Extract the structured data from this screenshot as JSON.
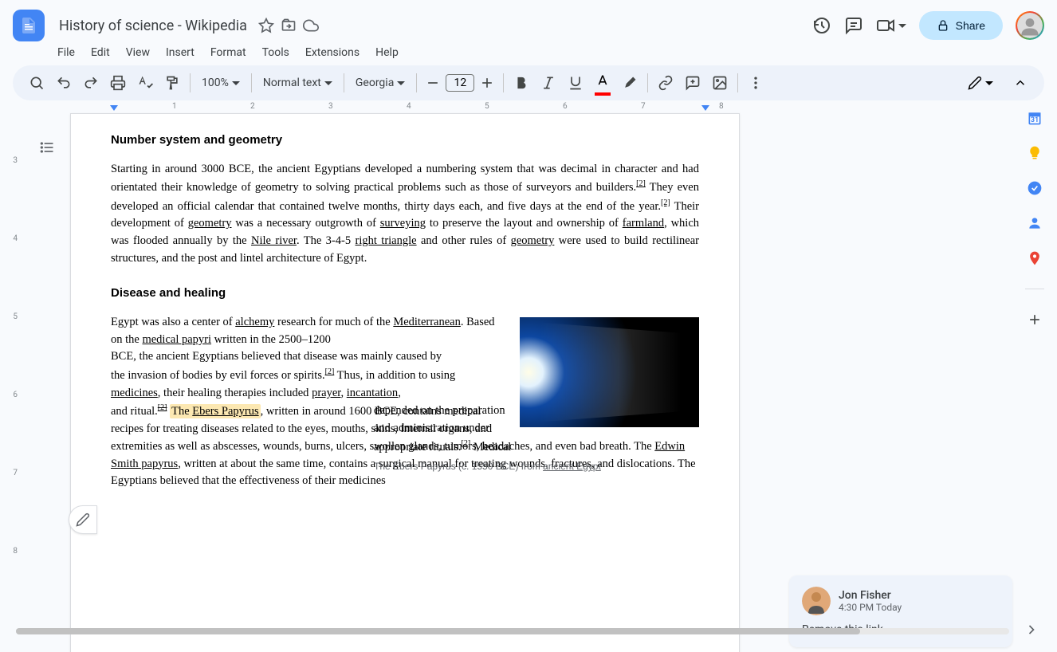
{
  "doc": {
    "title": "History of science - Wikipedia",
    "menu": [
      "File",
      "Edit",
      "View",
      "Insert",
      "Format",
      "Tools",
      "Extensions",
      "Help"
    ]
  },
  "toolbar": {
    "zoom": "100%",
    "style": "Normal text",
    "font": "Georgia",
    "font_size": "12"
  },
  "share_label": "Share",
  "ruler_top": [
    "1",
    "2",
    "3",
    "4",
    "5",
    "6",
    "7",
    "8"
  ],
  "ruler_left": [
    "3",
    "4",
    "5",
    "6",
    "7",
    "8"
  ],
  "content": {
    "h1": "Number system and geometry",
    "p1a": "Starting in around 3000 BCE, the ancient Egyptians developed a numbering system that was decimal in character and had orientated their knowledge of geometry to solving practical problems such as those of surveyors and builders.",
    "p1b": " They even developed an official calendar that contained twelve months, thirty days each, and five days at the end of the year.",
    "p1c": " Their development of ",
    "geometry1": "geometry",
    "p1d": " was a necessary outgrowth of ",
    "surveying": "surveying",
    "p1e": " to preserve the layout and ownership of ",
    "farmland": "farmland",
    "p1f": ", which was flooded annually by the ",
    "nile": "Nile river",
    "p1g": ". The 3-4-5 ",
    "right_triangle": "right triangle",
    "p1h": " and other rules of ",
    "geometry2": "geometry",
    "p1i": " were used to build rectilinear structures, and the post and lintel architecture of Egypt.",
    "h2": "Disease and healing",
    "p2a": "Egypt was also a center of ",
    "alchemy": "alchemy",
    "p2b": " research for much of the ",
    "mediterranean": "Mediterranean",
    "p2c": ". Based on the ",
    "medical_papyri": "medical papyri",
    "p2d": " written in the 2500–1200",
    "p3": "BCE, the ancient Egyptians believed that disease was mainly caused by",
    "p4a": "the invasion of bodies by evil forces or spirits.",
    "p4b": " Thus, in addition to using ",
    "medicines": "medicines",
    "p4c": ", their healing therapies included ",
    "prayer": "prayer",
    "p4d": ", ",
    "incantation": "incantation",
    "p4e": ",",
    "p5a": "and ritual.",
    "p5the": "The ",
    "ebers": "Ebers Papyrus",
    "p5b": ", written in around 1600 BCE, contains medical recipes for treating diseases related to the eyes, mouths, skins, internal organs, and extremities as well as abscesses, wounds, burns, ulcers, swollen glands, tumors, headaches, and even bad breath. The ",
    "edwin": "Edwin Smith papyrus",
    "p5c": ", written at about the same time, contains a surgical manual for treating wounds, fractures, and dislocations. The Egyptians believed that the effectiveness of their medicines",
    "p6a": "depended on the preparation and administration under appropriate rituals.",
    "p6b": " Medical",
    "caption_a": "The Ebers Papyrus (c. 1550 BCE) from ",
    "caption_link": "ancient Egypt",
    "ref": "[2]"
  },
  "comment": {
    "author": "Jon Fisher",
    "time": "4:30 PM Today",
    "text": "Remove this link"
  },
  "calendar_day": "31"
}
